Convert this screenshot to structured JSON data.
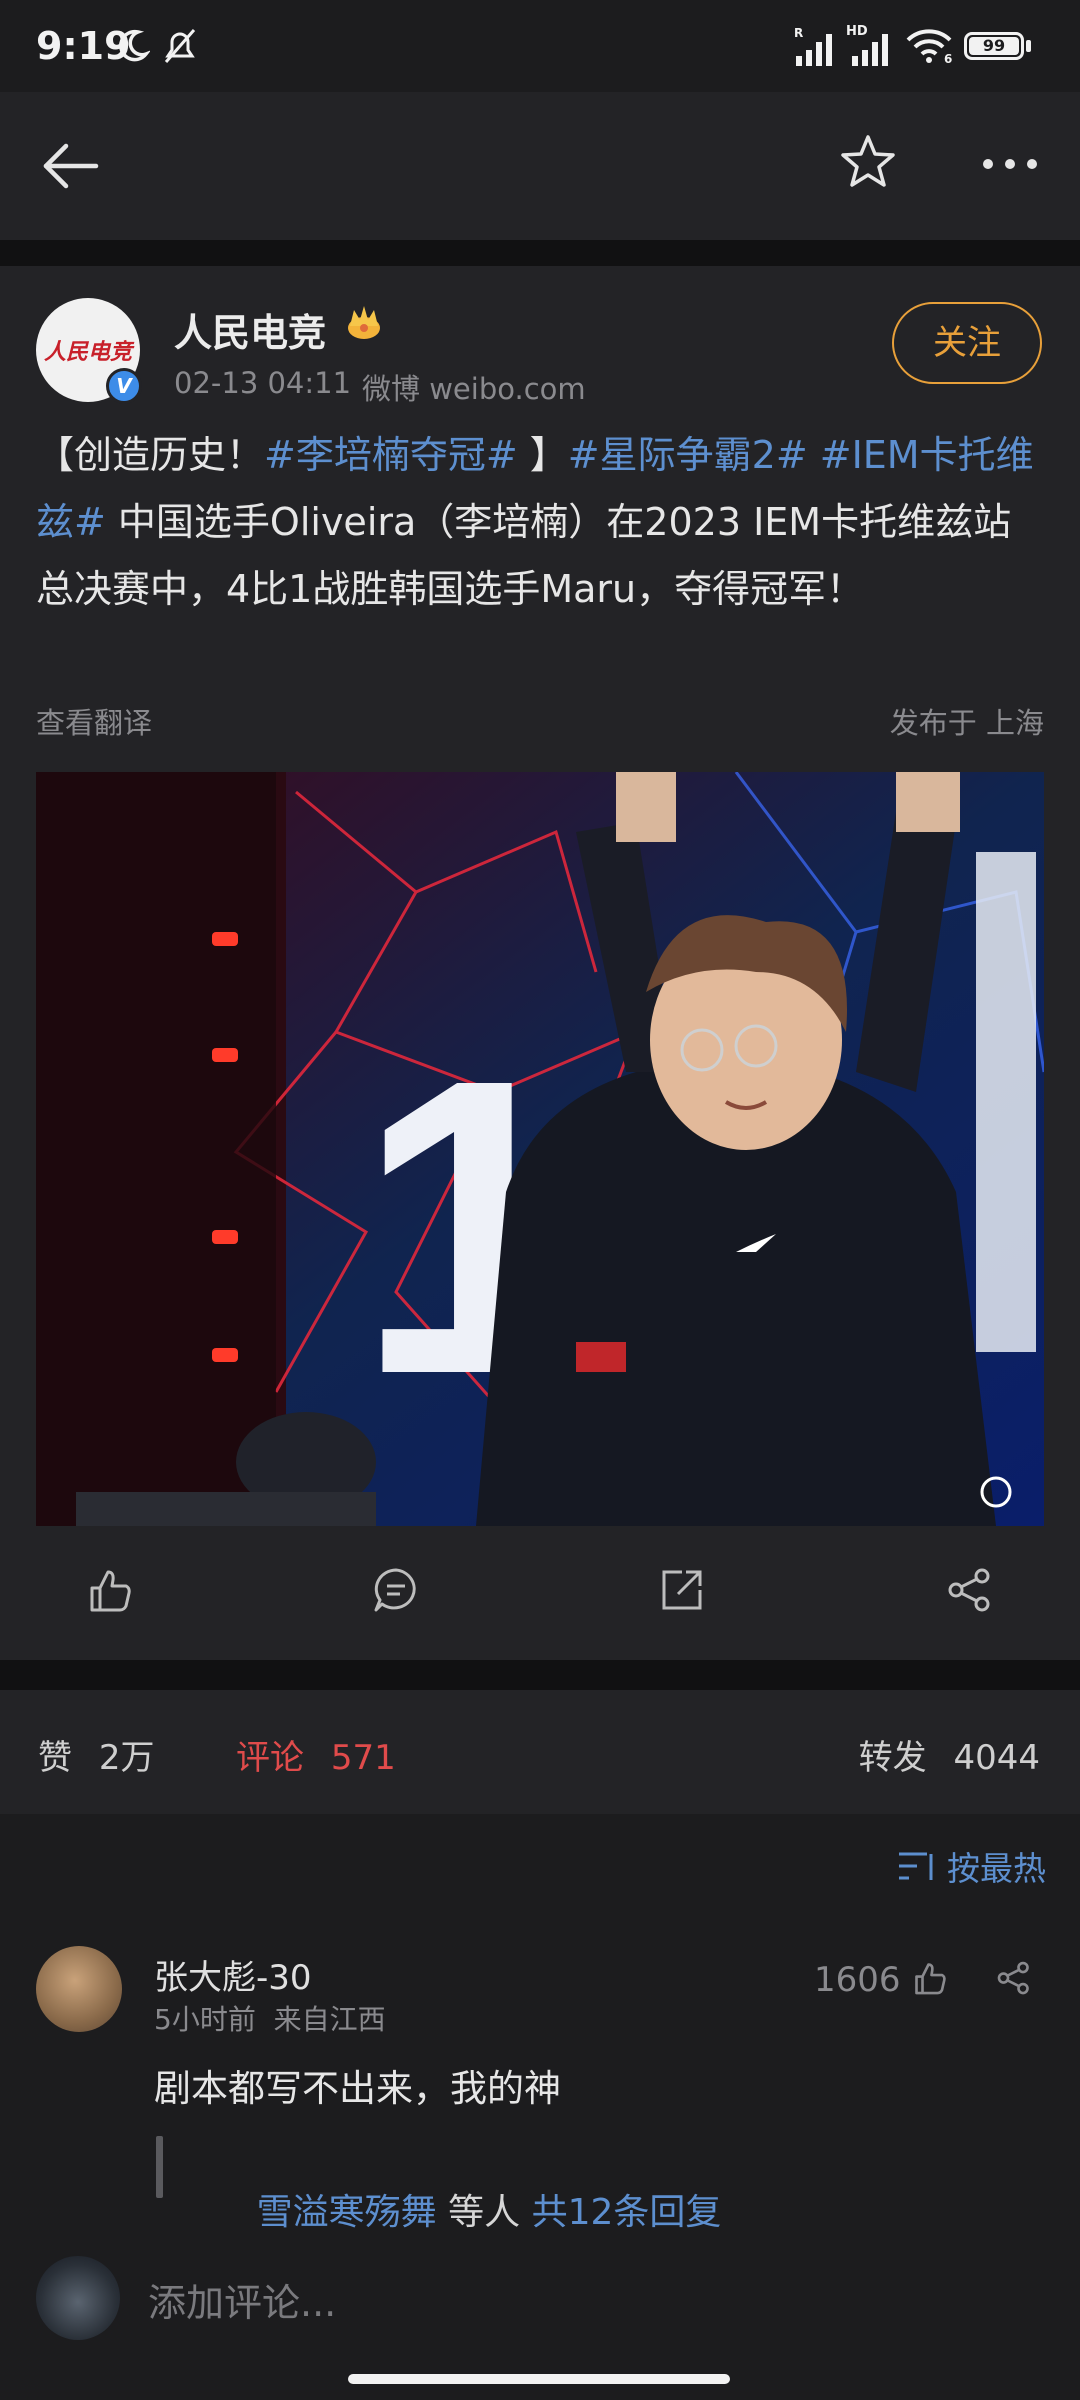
{
  "status_bar": {
    "time": "9:19",
    "network_label_1": "R",
    "network_label_2": "HD",
    "wifi_sub": "6",
    "battery": "99"
  },
  "post": {
    "author": "人民电竞",
    "avatar_text": "人民电竞",
    "timestamp": "02-13 04:11",
    "source": "微博 weibo.com",
    "follow_label": "关注",
    "content": [
      {
        "type": "text",
        "value": "【创造历史！"
      },
      {
        "type": "tag",
        "value": "#李培楠夺冠#"
      },
      {
        "type": "text",
        "value": " 】"
      },
      {
        "type": "tag",
        "value": "#星际争霸2#"
      },
      {
        "type": "text",
        "value": " "
      },
      {
        "type": "tag",
        "value": "#IEM卡托维兹#"
      },
      {
        "type": "text",
        "value": " 中国选手Oliveira（李培楠）在2023 IEM卡托维兹站总决赛中，4比1战胜韩国选手Maru，夺得冠军！"
      }
    ],
    "translate_label": "查看翻译",
    "location": "发布于 上海",
    "image_score": "1"
  },
  "stats": {
    "likes_label": "赞",
    "likes_count": "2万",
    "comments_label": "评论",
    "comments_count": "571",
    "reposts_label": "转发",
    "reposts_count": "4044"
  },
  "sort": {
    "label": "按最热"
  },
  "comment": {
    "username": "张大彪-30",
    "meta": "5小时前  来自江西",
    "likes": "1606",
    "text": "剧本都写不出来，我的神",
    "reply_user": "雪溢寒殇舞",
    "reply_mid": " 等人 ",
    "reply_count": "共12条回复"
  },
  "composer": {
    "placeholder": "添加评论..."
  },
  "colors": {
    "accent_blue": "#5d8fcf",
    "follow_orange": "#e8a03a",
    "comment_red": "#e04b4b"
  }
}
